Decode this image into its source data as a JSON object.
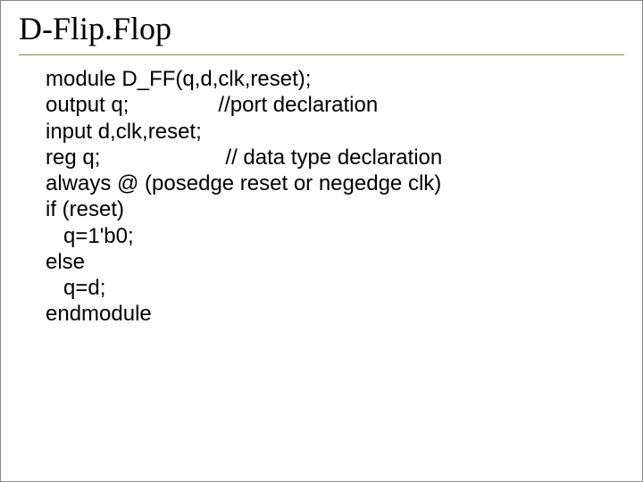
{
  "slide": {
    "title": "D-Flip.Flop",
    "code_lines": [
      "module D_FF(q,d,clk,reset);",
      "output q;               //port declaration",
      "input d,clk,reset;",
      "reg q;                     // data type declaration",
      "always @ (posedge reset or negedge clk)",
      "if (reset)",
      "   q=1'b0;",
      "else",
      "   q=d;",
      "endmodule"
    ]
  }
}
